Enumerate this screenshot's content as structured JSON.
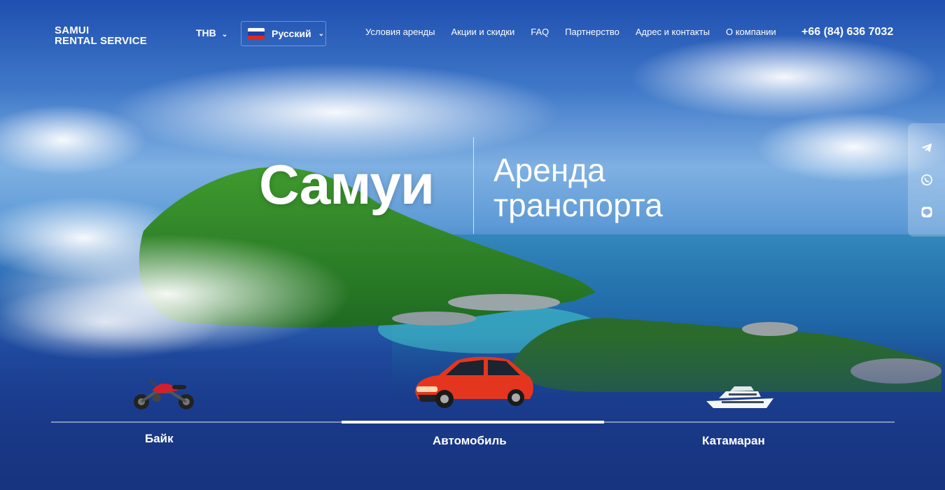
{
  "brand": {
    "logo_line1": "SAMUI",
    "logo_line2": "RENTAL SERVICE"
  },
  "header": {
    "currency": "THB",
    "language": "Русский",
    "menu": [
      "Условия аренды",
      "Акции и скидки",
      "FAQ",
      "Партнерство",
      "Адрес и контакты",
      "О компании"
    ],
    "phone": "+66 (84) 636 7032"
  },
  "hero": {
    "title": "Самуи",
    "subtitle_line1": "Аренда",
    "subtitle_line2": "транспорта"
  },
  "social": {
    "icons": [
      "telegram-icon",
      "whatsapp-icon",
      "line-icon"
    ]
  },
  "tabs": [
    {
      "label": "Байк",
      "icon": "motorcycle-icon"
    },
    {
      "label": "Автомобиль",
      "icon": "car-icon",
      "active": true
    },
    {
      "label": "Катамаран",
      "icon": "yacht-icon"
    }
  ],
  "colors": {
    "accent_logo": "#e8352b",
    "background": "#1b3a8c"
  }
}
